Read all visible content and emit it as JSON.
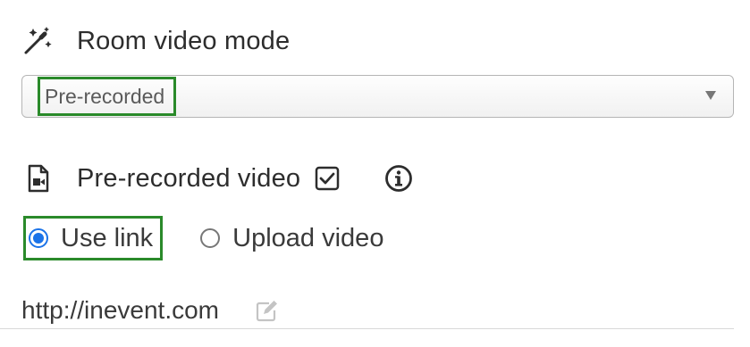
{
  "room_video_mode": {
    "title": "Room video mode",
    "icon": "magic-wand-icon",
    "select": {
      "selected": "Pre-recorded",
      "arrow_icon": "dropdown-arrow-icon"
    }
  },
  "prerecorded_video": {
    "title": "Pre-recorded video",
    "icon": "video-file-icon",
    "checkbox_icon": "checked-checkbox-icon",
    "checked": true,
    "info_icon": "info-icon",
    "source_options": [
      {
        "label": "Use link",
        "selected": true
      },
      {
        "label": "Upload video",
        "selected": false
      }
    ],
    "link": {
      "value": "http://inevent.com",
      "edit_icon": "edit-icon"
    }
  },
  "colors": {
    "highlight": "#2a8a2a",
    "radio_selected": "#1b73e8",
    "text": "#2d2d2d"
  }
}
